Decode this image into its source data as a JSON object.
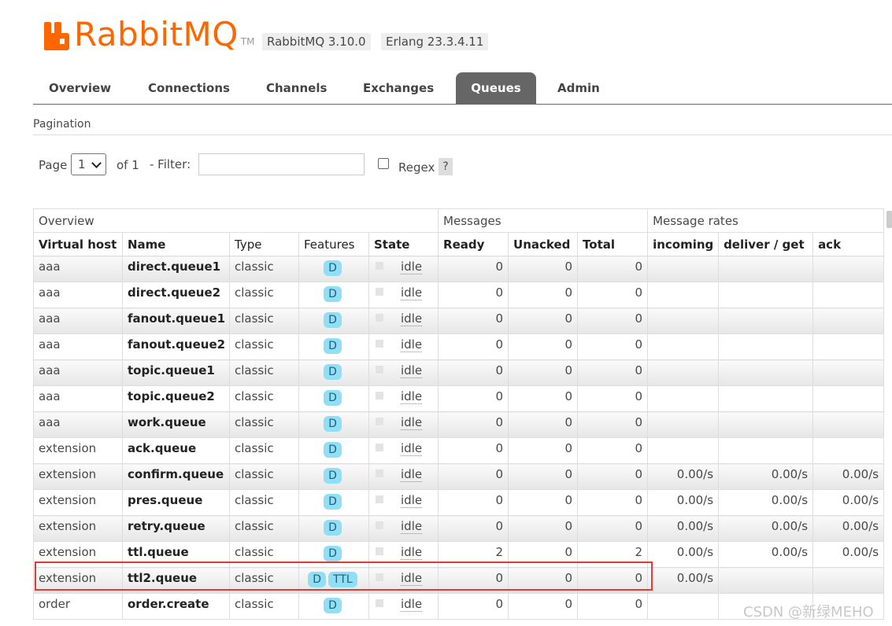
{
  "header": {
    "logo_text": "RabbitMQ",
    "logo_tm": "TM",
    "rabbitmq_version": "RabbitMQ 3.10.0",
    "erlang_version": "Erlang 23.3.4.11",
    "brand_color": "#ff6600"
  },
  "tabs": [
    {
      "label": "Overview",
      "active": false
    },
    {
      "label": "Connections",
      "active": false
    },
    {
      "label": "Channels",
      "active": false
    },
    {
      "label": "Exchanges",
      "active": false
    },
    {
      "label": "Queues",
      "active": true
    },
    {
      "label": "Admin",
      "active": false
    }
  ],
  "pagination": {
    "title": "Pagination",
    "page_label": "Page",
    "page_value": "1",
    "of_label": "of 1",
    "filter_label": "- Filter:",
    "filter_value": "",
    "regex_label": "Regex",
    "regex_checked": false,
    "help_label": "?"
  },
  "table": {
    "groups": [
      "Overview",
      "Messages",
      "Message rates"
    ],
    "columns": [
      "Virtual host",
      "Name",
      "Type",
      "Features",
      "State",
      "Ready",
      "Unacked",
      "Total",
      "incoming",
      "deliver / get",
      "ack"
    ],
    "rows": [
      {
        "vhost": "aaa",
        "name": "direct.queue1",
        "type": "classic",
        "features": [
          "D"
        ],
        "state": "idle",
        "ready": "0",
        "unacked": "0",
        "total": "0",
        "incoming": "",
        "deliver_get": "",
        "ack": ""
      },
      {
        "vhost": "aaa",
        "name": "direct.queue2",
        "type": "classic",
        "features": [
          "D"
        ],
        "state": "idle",
        "ready": "0",
        "unacked": "0",
        "total": "0",
        "incoming": "",
        "deliver_get": "",
        "ack": ""
      },
      {
        "vhost": "aaa",
        "name": "fanout.queue1",
        "type": "classic",
        "features": [
          "D"
        ],
        "state": "idle",
        "ready": "0",
        "unacked": "0",
        "total": "0",
        "incoming": "",
        "deliver_get": "",
        "ack": ""
      },
      {
        "vhost": "aaa",
        "name": "fanout.queue2",
        "type": "classic",
        "features": [
          "D"
        ],
        "state": "idle",
        "ready": "0",
        "unacked": "0",
        "total": "0",
        "incoming": "",
        "deliver_get": "",
        "ack": ""
      },
      {
        "vhost": "aaa",
        "name": "topic.queue1",
        "type": "classic",
        "features": [
          "D"
        ],
        "state": "idle",
        "ready": "0",
        "unacked": "0",
        "total": "0",
        "incoming": "",
        "deliver_get": "",
        "ack": ""
      },
      {
        "vhost": "aaa",
        "name": "topic.queue2",
        "type": "classic",
        "features": [
          "D"
        ],
        "state": "idle",
        "ready": "0",
        "unacked": "0",
        "total": "0",
        "incoming": "",
        "deliver_get": "",
        "ack": ""
      },
      {
        "vhost": "aaa",
        "name": "work.queue",
        "type": "classic",
        "features": [
          "D"
        ],
        "state": "idle",
        "ready": "0",
        "unacked": "0",
        "total": "0",
        "incoming": "",
        "deliver_get": "",
        "ack": ""
      },
      {
        "vhost": "extension",
        "name": "ack.queue",
        "type": "classic",
        "features": [
          "D"
        ],
        "state": "idle",
        "ready": "0",
        "unacked": "0",
        "total": "0",
        "incoming": "",
        "deliver_get": "",
        "ack": ""
      },
      {
        "vhost": "extension",
        "name": "confirm.queue",
        "type": "classic",
        "features": [
          "D"
        ],
        "state": "idle",
        "ready": "0",
        "unacked": "0",
        "total": "0",
        "incoming": "0.00/s",
        "deliver_get": "0.00/s",
        "ack": "0.00/s"
      },
      {
        "vhost": "extension",
        "name": "pres.queue",
        "type": "classic",
        "features": [
          "D"
        ],
        "state": "idle",
        "ready": "0",
        "unacked": "0",
        "total": "0",
        "incoming": "0.00/s",
        "deliver_get": "0.00/s",
        "ack": "0.00/s"
      },
      {
        "vhost": "extension",
        "name": "retry.queue",
        "type": "classic",
        "features": [
          "D"
        ],
        "state": "idle",
        "ready": "0",
        "unacked": "0",
        "total": "0",
        "incoming": "0.00/s",
        "deliver_get": "0.00/s",
        "ack": "0.00/s"
      },
      {
        "vhost": "extension",
        "name": "ttl.queue",
        "type": "classic",
        "features": [
          "D"
        ],
        "state": "idle",
        "ready": "2",
        "unacked": "0",
        "total": "2",
        "incoming": "0.00/s",
        "deliver_get": "0.00/s",
        "ack": "0.00/s"
      },
      {
        "vhost": "extension",
        "name": "ttl2.queue",
        "type": "classic",
        "features": [
          "D",
          "TTL"
        ],
        "state": "idle",
        "ready": "0",
        "unacked": "0",
        "total": "0",
        "incoming": "0.00/s",
        "deliver_get": "",
        "ack": ""
      },
      {
        "vhost": "order",
        "name": "order.create",
        "type": "classic",
        "features": [
          "D"
        ],
        "state": "idle",
        "ready": "0",
        "unacked": "0",
        "total": "0",
        "incoming": "",
        "deliver_get": "",
        "ack": ""
      }
    ]
  },
  "highlight_color": "#e53935",
  "watermark": "CSDN @新绿MEHO"
}
